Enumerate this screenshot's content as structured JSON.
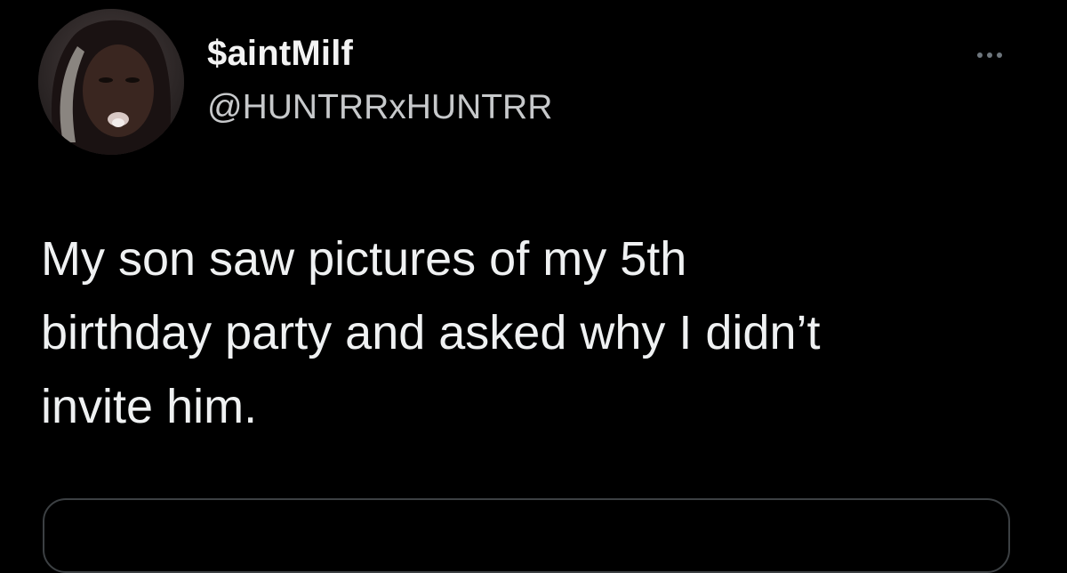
{
  "tweet": {
    "author": {
      "display_name": "$aintMilf",
      "handle": "@HUNTRRxHUNTRR",
      "avatar_icon": "profile-avatar"
    },
    "more_icon": "more-horizontal-icon",
    "text": "My son saw pictures of my 5th\nbirthday party and asked why I didn’t\ninvite him."
  },
  "colors": {
    "background": "#000000",
    "text": "#e7e9ea",
    "secondary_text": "#c7c9cb",
    "icon": "#6e767d"
  }
}
